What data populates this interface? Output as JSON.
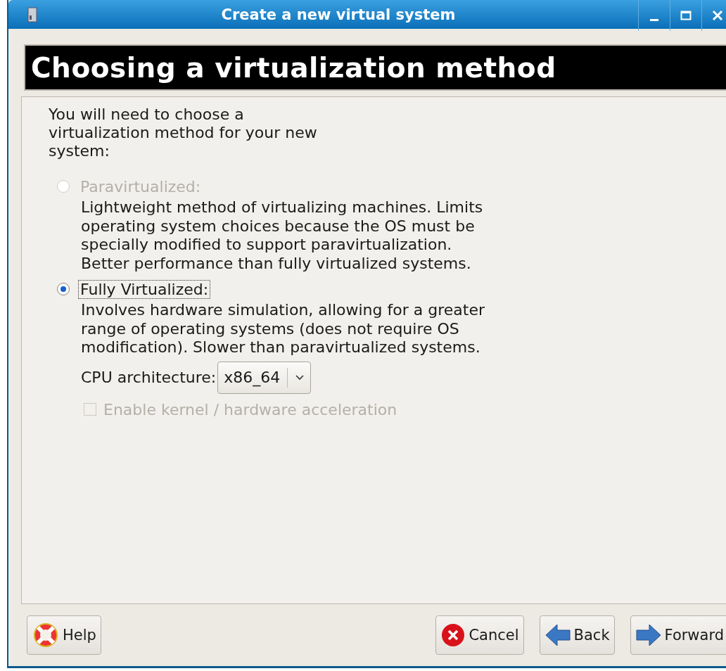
{
  "window": {
    "title": "Create a new virtual system"
  },
  "header": {
    "title": "Choosing a virtualization method"
  },
  "intro": "You will need to choose a virtualization method for your new system:",
  "options": [
    {
      "label": "Paravirtualized:",
      "description": "Lightweight method of virtualizing machines. Limits operating system choices because the OS must be specially modified to support paravirtualization. Better performance than fully virtualized systems.",
      "selected": false,
      "disabled": true,
      "focused": false
    },
    {
      "label": "Fully Virtualized:",
      "description": "Involves hardware simulation, allowing for a greater range of operating systems (does not require OS modification). Slower than paravirtualized systems.",
      "selected": true,
      "disabled": false,
      "focused": true
    }
  ],
  "cpu_architecture": {
    "label": "CPU architecture:",
    "value": "x86_64"
  },
  "acceleration": {
    "label": "Enable kernel / hardware acceleration",
    "checked": false,
    "disabled": true
  },
  "buttons": [
    {
      "kind": "help",
      "label": "Help"
    },
    {
      "kind": "cancel",
      "label": "Cancel"
    },
    {
      "kind": "back",
      "label": "Back"
    },
    {
      "kind": "forward",
      "label": "Forward"
    }
  ]
}
